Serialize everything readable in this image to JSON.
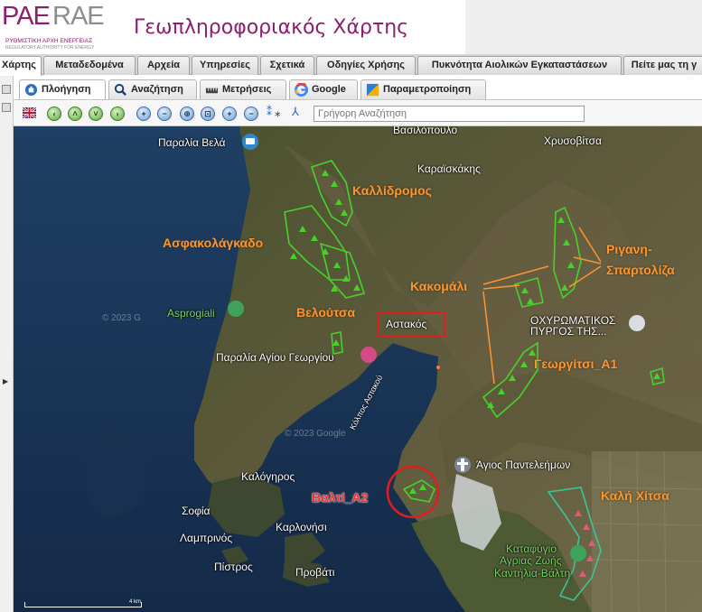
{
  "header": {
    "logo": {
      "pae": "PAE",
      "rae": "RAE",
      "sub1": "ΡΥΘΜΙΣΤΙΚΗ ΑΡΧΗ ΕΝΕΡΓΕΙΑΣ",
      "sub2": "REGULATORY AUTHORITY FOR ENERGY"
    },
    "title": "Γεωπληροφοριακός Χάρτης"
  },
  "main_tabs": [
    {
      "label": "Χάρτης",
      "active": true
    },
    {
      "label": "Μεταδεδομένα"
    },
    {
      "label": "Αρχεία"
    },
    {
      "label": "Υπηρεσίες"
    },
    {
      "label": "Σχετικά"
    },
    {
      "label": "Οδηγίες Χρήσης"
    },
    {
      "label": "Πυκνότητα Αιολικών Εγκαταστάσεων"
    },
    {
      "label": "Πείτε μας τη γ"
    }
  ],
  "sub_tabs": [
    {
      "label": "Πλοήγηση",
      "icon": "hand-icon",
      "active": true
    },
    {
      "label": "Αναζήτηση",
      "icon": "search-icon"
    },
    {
      "label": "Μετρήσεις",
      "icon": "ruler-icon"
    },
    {
      "label": "Google",
      "icon": "google-icon"
    },
    {
      "label": "Παραμετροποίηση",
      "icon": "settings-icon"
    }
  ],
  "toolbar": {
    "language_icon": "uk-flag-icon",
    "search_placeholder": "Γρήγορη Αναζήτηση",
    "tools": [
      "previous-extent-icon",
      "pan-up-icon",
      "pan-down-icon",
      "next-extent-icon",
      "zoom-in-icon",
      "zoom-out-icon",
      "zoom-box-icon",
      "zoom-extent-icon",
      "zoom-in-plus-icon",
      "zoom-out-minus-icon",
      "identify-icon",
      "info-icon",
      "network-icon"
    ]
  },
  "map": {
    "place_labels": [
      "Βασιλόπουλο",
      "Παραλία Βελά",
      "Χρυσοβίτσα",
      "Καραϊσκάκης",
      "Asprogiali",
      "Αστακός",
      "ΟΧΥΡΩΜΑΤΙΚΟΣ",
      "ΠΥΡΓΟΣ ΤΗΣ...",
      "Παραλία Αγίου Γεωργίου",
      "Κόλπος Αστακού",
      "Άγιος Παντελεήμων",
      "Καλόγηρος",
      "Σοφία",
      "Καρλονήσι",
      "Λαμπρινός",
      "Πίστρος",
      "Προβάτι",
      "Καταφύγιο",
      "Άγριας Ζωής",
      "Καντήλια-Βάλτη"
    ],
    "project_labels": [
      "Καλλίδρομος",
      "Ασφακολάγκαδο",
      "Βελούτσα",
      "Κακομάλι",
      "Ριγανη-",
      "Σπαρτολίζα",
      "Γεωργίτσι_Α1",
      "Βαλτί_Α2",
      "Καλή Χίτσα"
    ],
    "watermarks": [
      "© 2023 G",
      "© 2023 Google"
    ],
    "scale_label": "4 km",
    "colors": {
      "project_green": "#46d22b",
      "project_teal": "#3fc39a",
      "tag_orange": "#ff9530",
      "tag_red": "#ff2a2a",
      "highlight_red": "#e01e1e"
    }
  }
}
